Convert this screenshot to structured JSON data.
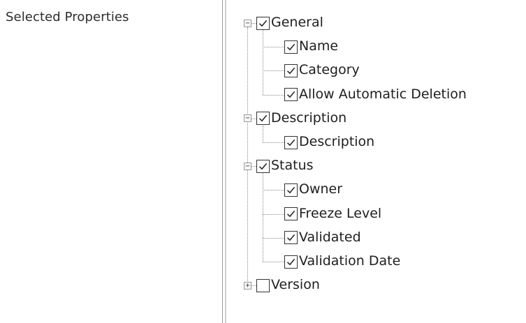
{
  "form": {
    "selected_properties_label": "Selected Properties"
  },
  "tree": {
    "groups": [
      {
        "label": "General",
        "checked": true,
        "expanded": true,
        "children": [
          {
            "label": "Name",
            "checked": true
          },
          {
            "label": "Category",
            "checked": true
          },
          {
            "label": "Allow Automatic Deletion",
            "checked": true
          }
        ]
      },
      {
        "label": "Description",
        "checked": true,
        "expanded": true,
        "children": [
          {
            "label": "Description",
            "checked": true
          }
        ]
      },
      {
        "label": "Status",
        "checked": true,
        "expanded": true,
        "children": [
          {
            "label": "Owner",
            "checked": true
          },
          {
            "label": "Freeze Level",
            "checked": true
          },
          {
            "label": "Validated",
            "checked": true
          },
          {
            "label": "Validation Date",
            "checked": true
          }
        ]
      },
      {
        "label": "Version",
        "checked": false,
        "expanded": false,
        "children": []
      }
    ],
    "icons": {
      "expanded": "collapse-minus-icon",
      "collapsed": "expand-plus-icon",
      "checked": "checkmark-icon"
    }
  }
}
